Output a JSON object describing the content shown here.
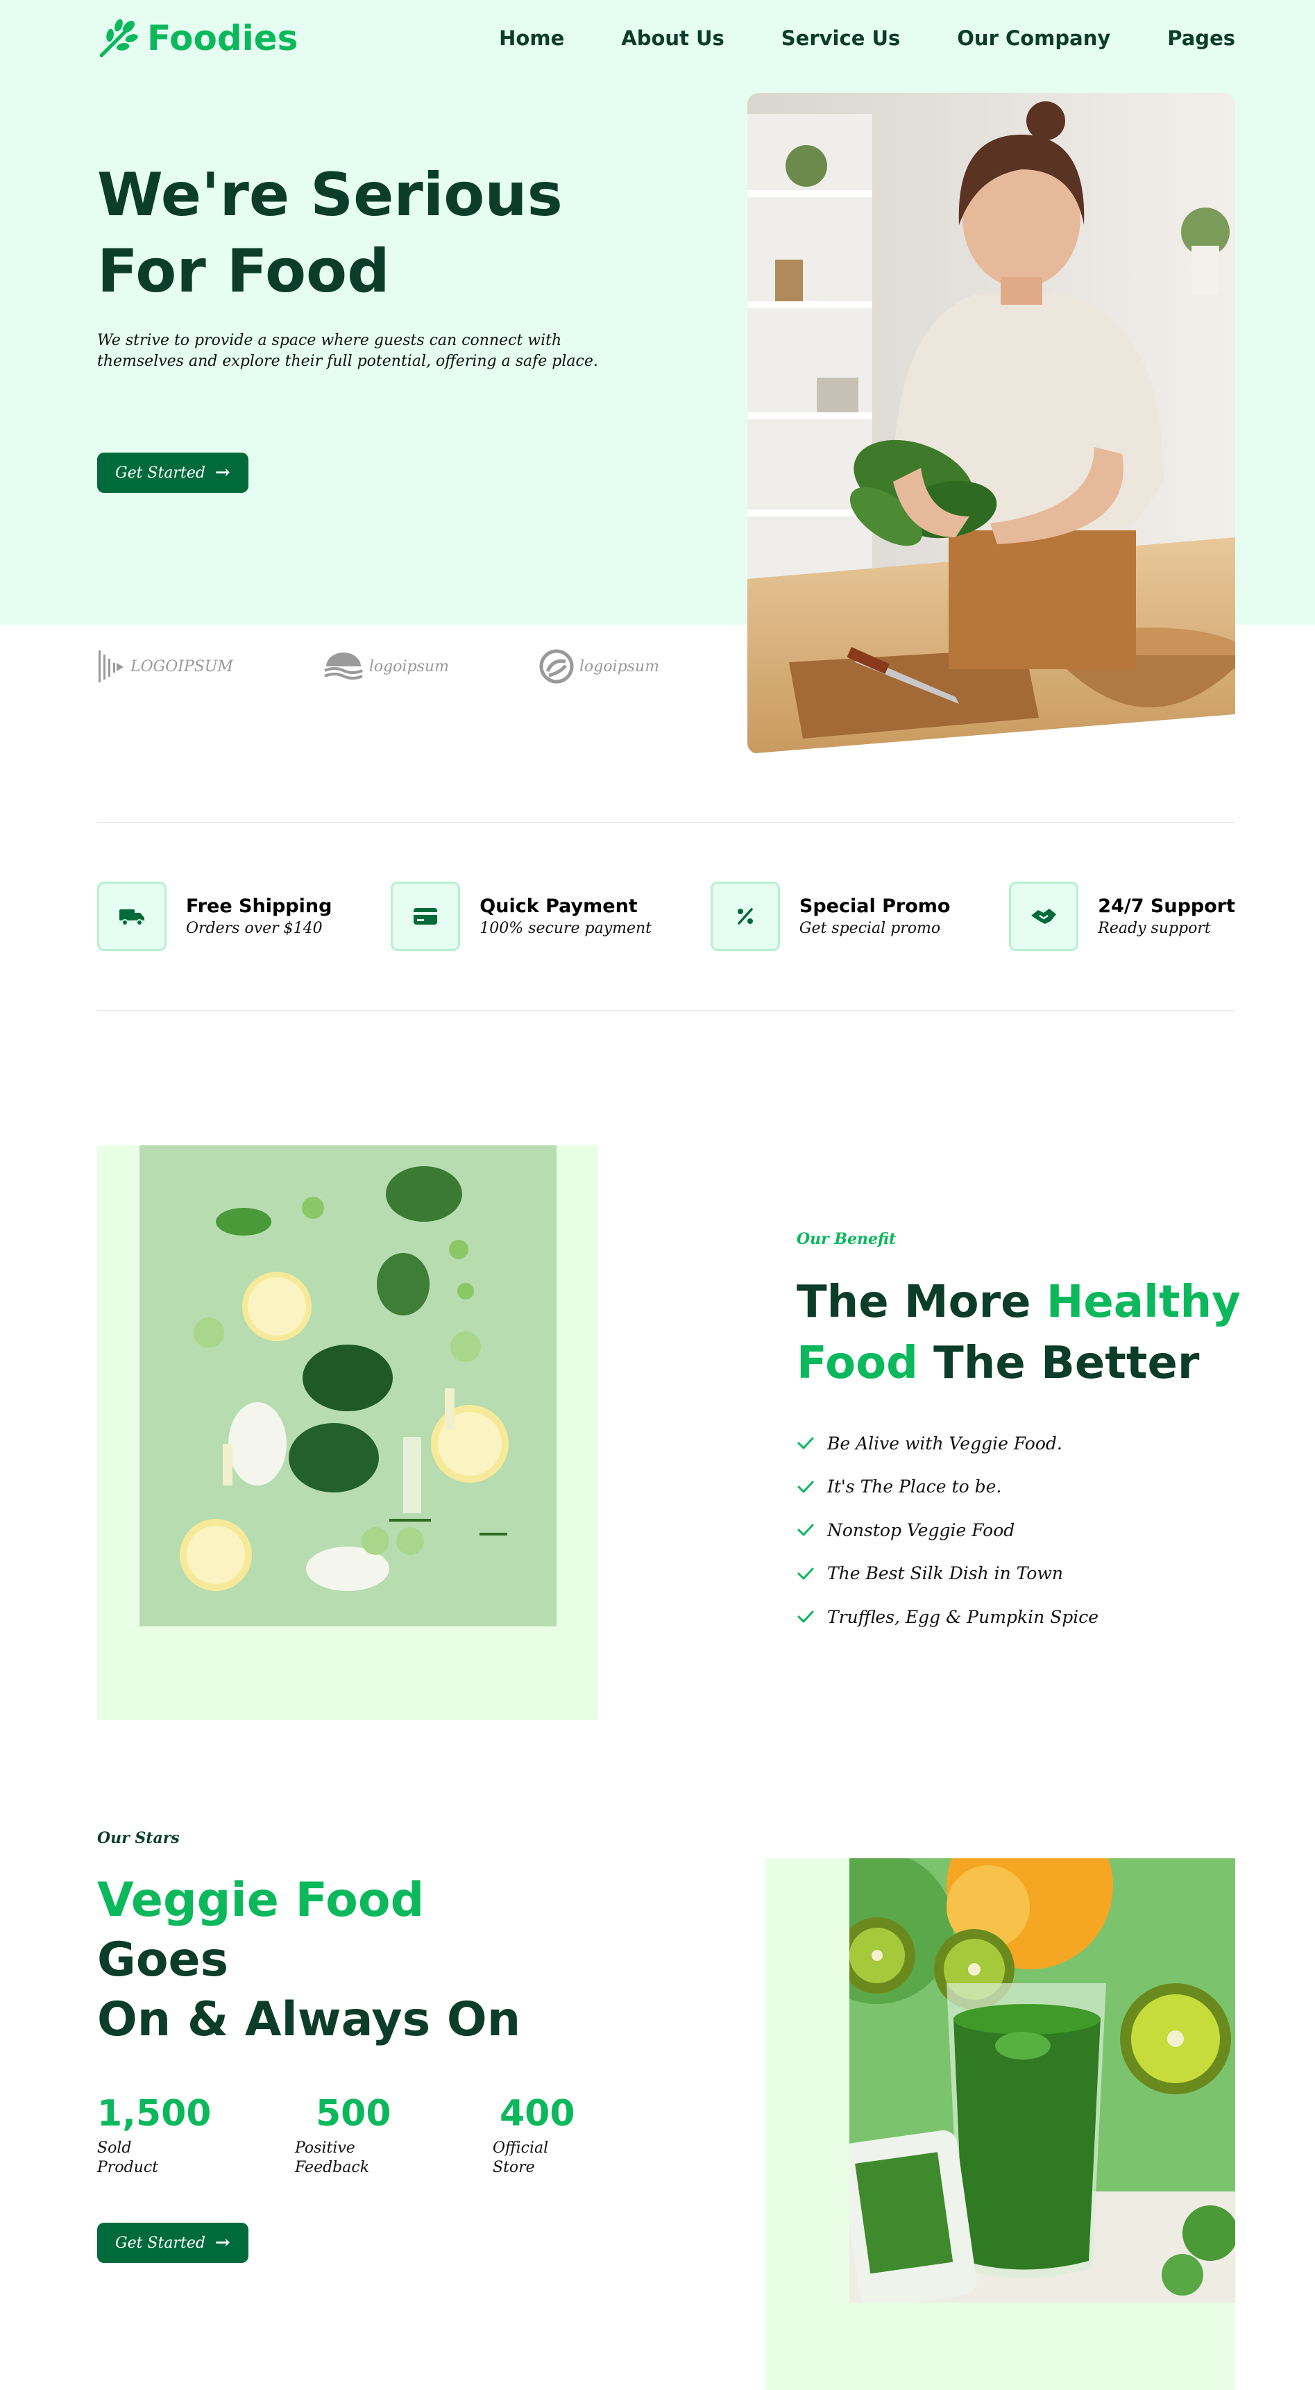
{
  "brand": {
    "logo_text": "Foodies"
  },
  "nav": {
    "items": [
      "Home",
      "About Us",
      "Service Us",
      "Our Company",
      "Pages"
    ]
  },
  "hero": {
    "title_line1": "We're Serious",
    "title_line2": "For Food",
    "description": "We strive to provide a space where guests can connect with themselves and explore their full potential, offering a safe place.",
    "cta_label": "Get Started"
  },
  "partners": [
    "LOGOIPSUM",
    "logoipsum",
    "logoipsum"
  ],
  "features": [
    {
      "icon": "truck-icon",
      "title": "Free Shipping",
      "subtitle": "Orders over $140"
    },
    {
      "icon": "card-icon",
      "title": "Quick Payment",
      "subtitle": "100% secure payment"
    },
    {
      "icon": "percent-icon",
      "title": "Special Promo",
      "subtitle": "Get special promo"
    },
    {
      "icon": "handshake-icon",
      "title": "24/7 Support",
      "subtitle": "Ready support"
    }
  ],
  "benefit": {
    "eyebrow": "Our Benefit",
    "title_part1": "The More ",
    "title_accent1": "Healthy",
    "title_accent2": "Food",
    "title_part2": " The Better",
    "items": [
      "Be Alive with Veggie Food.",
      "It's The Place to be.",
      "Nonstop Veggie Food",
      "The Best Silk Dish in Town",
      "Truffles, Egg & Pumpkin Spice"
    ]
  },
  "stars": {
    "eyebrow": "Our Stars",
    "title_accent": "Veggie Food",
    "title_line2": "Goes",
    "title_line3": "On & Always On",
    "stats": [
      {
        "value": "1,500",
        "label_line1": "Sold",
        "label_line2": "Product"
      },
      {
        "value": "500",
        "label_line1": "Positive",
        "label_line2": "Feedback"
      },
      {
        "value": "400",
        "label_line1": "Official",
        "label_line2": "Store"
      }
    ],
    "cta_label": "Get Started"
  },
  "colors": {
    "accent": "#0bb85c",
    "dark": "#0b3d2a",
    "button": "#006b3a",
    "hero_bg": "#e6fdf1",
    "panel_bg": "#e8ffe6"
  }
}
